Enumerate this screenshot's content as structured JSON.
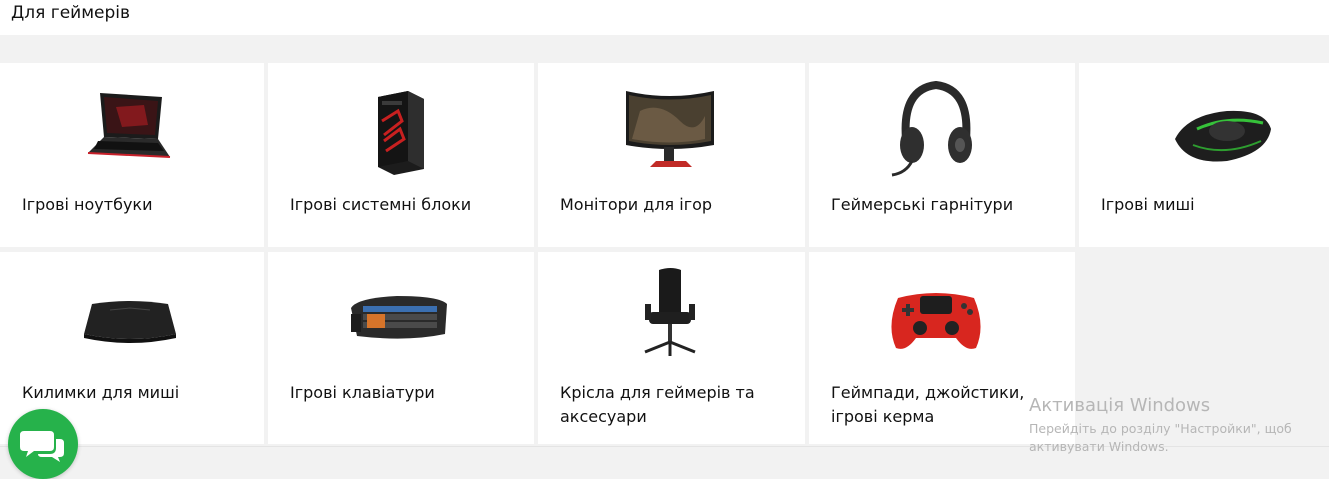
{
  "section": {
    "title": "Для геймерів"
  },
  "categories": [
    {
      "label": "Ігрові ноутбуки",
      "icon": "gaming-laptop-icon"
    },
    {
      "label": "Ігрові системні блоки",
      "icon": "gaming-pc-case-icon"
    },
    {
      "label": "Монітори для ігор",
      "icon": "gaming-monitor-icon"
    },
    {
      "label": "Геймерські гарнітури",
      "icon": "gaming-headset-icon"
    },
    {
      "label": "Ігрові миші",
      "icon": "gaming-mouse-icon"
    },
    {
      "label": "Килимки для миші",
      "icon": "mouse-pad-icon"
    },
    {
      "label": "Ігрові клавіатури",
      "icon": "gaming-keyboard-icon"
    },
    {
      "label": "Крісла для геймерів та аксесуари",
      "icon": "gaming-chair-icon"
    },
    {
      "label": "Геймпади, джойстики, ігрові керма",
      "icon": "gamepad-icon"
    }
  ],
  "watermark": {
    "title": "Активація Windows",
    "subtitle": "Перейдіть до розділу \"Настройки\", щоб активувати Windows."
  },
  "chat": {
    "icon": "chat-bubbles-icon",
    "color": "#26b24b"
  },
  "colors": {
    "page_bg": "#f2f2f2",
    "tile_bg": "#ffffff",
    "chat_green": "#26b24b"
  }
}
